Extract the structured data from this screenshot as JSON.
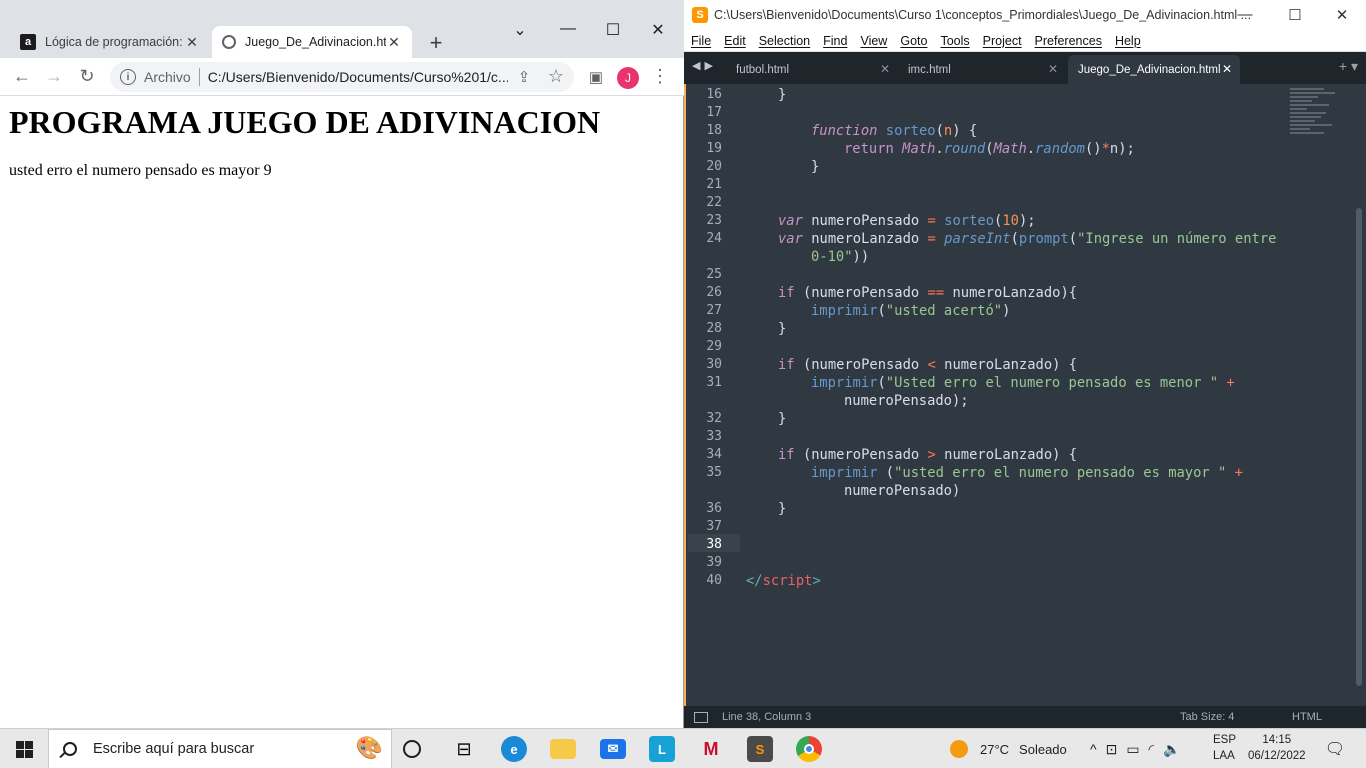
{
  "chrome": {
    "tabs": [
      {
        "title": "Lógica de programación: C",
        "favicon": "a",
        "active": false
      },
      {
        "title": "Juego_De_Adivinacion.htm",
        "favicon": "globe",
        "active": true
      }
    ],
    "new_tab": "+",
    "address": {
      "scheme_label": "Archivo",
      "url": "C:/Users/Bienvenido/Documents/Curso%201/c..."
    },
    "avatar_letter": "J",
    "page": {
      "heading": "PROGRAMA JUEGO DE ADIVINACION",
      "message": "usted erro el numero pensado es mayor 9"
    }
  },
  "sublime": {
    "title": "C:\\Users\\Bienvenido\\Documents\\Curso 1\\conceptos_Primordiales\\Juego_De_Adivinacion.html ...",
    "menu": [
      "File",
      "Edit",
      "Selection",
      "Find",
      "View",
      "Goto",
      "Tools",
      "Project",
      "Preferences",
      "Help"
    ],
    "tabs": [
      {
        "label": "futbol.html",
        "active": false
      },
      {
        "label": "imc.html",
        "active": false
      },
      {
        "label": "Juego_De_Adivinacion.html",
        "active": true
      }
    ],
    "line_numbers": [
      "16",
      "17",
      "18",
      "19",
      "20",
      "21",
      "22",
      "23",
      "24",
      "25",
      "26",
      "27",
      "28",
      "29",
      "30",
      "31",
      "32",
      "33",
      "34",
      "35",
      "36",
      "37",
      "38",
      "39",
      "40"
    ],
    "current_line": "38",
    "status": {
      "position": "Line 38, Column 3",
      "tab_size": "Tab Size: 4",
      "syntax": "HTML"
    },
    "code": {
      "l16": "}",
      "l18_kw": "function",
      "l18_fn": "sorteo",
      "l18_p": "n",
      "l18_end": ") {",
      "l19_kw": "return",
      "l19_obj": "Math",
      "l19_m": "round",
      "l19_obj2": "Math",
      "l19_m2": "random",
      "l19_end": "n);",
      "l20": "}",
      "l23_kw": "var",
      "l23_var": "numeroPensado",
      "l23_fn": "sorteo",
      "l23_num": "10",
      "l23_end": ");",
      "l24_kw": "var",
      "l24_var": "numeroLanzado",
      "l24_fn": "parseInt",
      "l24_fn2": "prompt",
      "l24_str": "\"Ingrese un número entre",
      "l24b_str": "0-10\"",
      "l24b_end": "))",
      "l26_if": "if",
      "l26_a": "(numeroPensado",
      "l26_op": "==",
      "l26_b": "numeroLanzado){",
      "l27_fn": "imprimir",
      "l27_str": "\"usted acertó\"",
      "l27_end": ")",
      "l28": "}",
      "l30_if": "if",
      "l30_a": "(numeroPensado",
      "l30_op": "<",
      "l30_b": "numeroLanzado) {",
      "l31_fn": "imprimir",
      "l31_str": "\"Usted erro el numero pensado es menor \"",
      "l31_op": "+",
      "l31b": "numeroPensado);",
      "l32": "}",
      "l34_if": "if",
      "l34_a": "(numeroPensado",
      "l34_op": ">",
      "l34_b": "numeroLanzado) {",
      "l35_fn": "imprimir",
      "l35_str": "\"usted erro el numero pensado es mayor \"",
      "l35_op": "+",
      "l35b": "numeroPensado)",
      "l36": "}",
      "l40_open": "</",
      "l40_tag": "script",
      "l40_close": ">"
    }
  },
  "taskbar": {
    "search_placeholder": "Escribe aquí para buscar",
    "weather": {
      "temp": "27°C",
      "condition": "Soleado"
    },
    "language": {
      "line1": "ESP",
      "line2": "LAA"
    },
    "time": "14:15",
    "date": "06/12/2022",
    "icons": [
      "task-view-icon",
      "widgets-icon",
      "edge-icon",
      "file-explorer-icon",
      "mail-icon",
      "l-app-icon",
      "mcafee-icon",
      "sublime-icon",
      "chrome-icon"
    ]
  }
}
